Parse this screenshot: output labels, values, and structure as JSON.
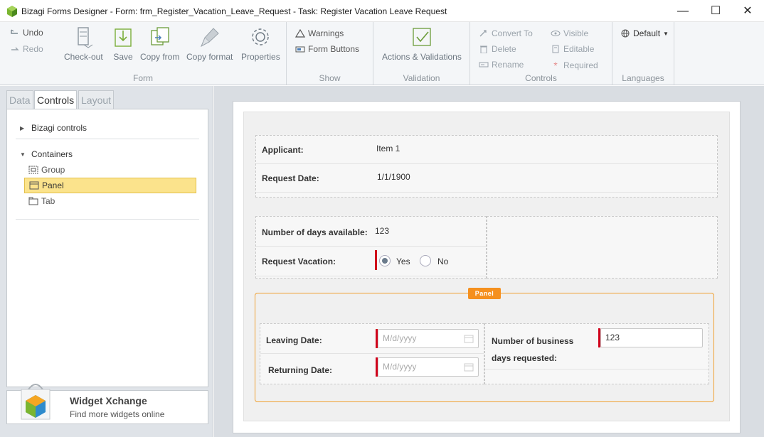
{
  "window": {
    "title": "Bizagi Forms Designer  - Form: frm_Register_Vacation_Leave_Request - Task:  Register Vacation Leave Request",
    "min_glyph": "—",
    "max_glyph": "☐",
    "close_glyph": "✕"
  },
  "ribbon": {
    "undo": "Undo",
    "redo": "Redo",
    "form_group": "Form",
    "checkout": "Check-out",
    "save": "Save",
    "copy_from": "Copy from",
    "copy_format": "Copy format",
    "properties": "Properties",
    "show_group": "Show",
    "warnings": "Warnings",
    "form_buttons": "Form Buttons",
    "validation_group": "Validation",
    "actions_validations": "Actions & Validations",
    "controls_group": "Controls",
    "convert_to": "Convert To",
    "delete": "Delete",
    "rename": "Rename",
    "visible": "Visible",
    "editable": "Editable",
    "required": "Required",
    "languages_group": "Languages",
    "language_value": "Default"
  },
  "left": {
    "tabs": [
      "Data",
      "Controls",
      "Layout"
    ],
    "tree": {
      "bizagi_controls": "Bizagi controls",
      "containers": "Containers",
      "items": [
        "Group",
        "Panel",
        "Tab"
      ]
    },
    "widget": {
      "title": "Widget Xchange",
      "subtitle": "Find more widgets online"
    }
  },
  "form": {
    "applicant_label": "Applicant:",
    "applicant_value": "Item 1",
    "request_date_label": "Request Date:",
    "request_date_value": "1/1/1900",
    "days_available_label": "Number of days available:",
    "days_available_value": "123",
    "request_vacation_label": "Request Vacation:",
    "yes": "Yes",
    "no": "No",
    "panel_badge": "Panel",
    "leaving_date_label": "Leaving Date:",
    "returning_date_label": "Returning Date:",
    "date_placeholder": "M/d/yyyy",
    "business_days_label_1": "Number of business",
    "business_days_label_2": "days requested:",
    "business_days_value": "123"
  },
  "colors": {
    "required": "#d0021b",
    "panel_accent": "#f5901e",
    "selection": "#fbe38c"
  }
}
